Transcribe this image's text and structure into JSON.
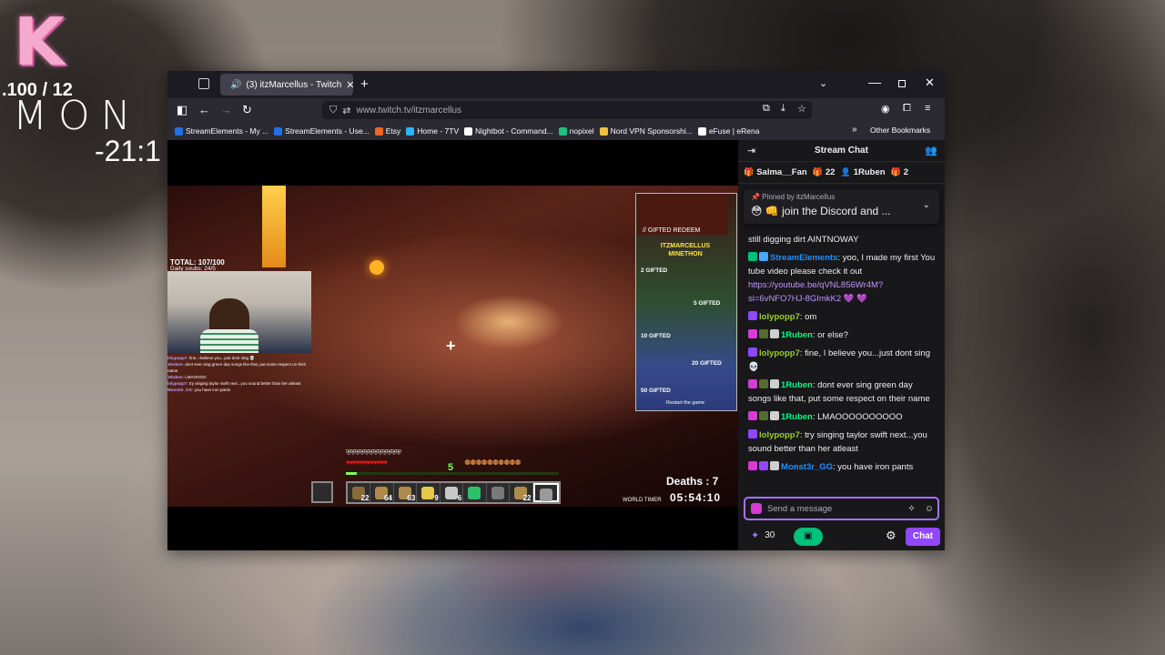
{
  "desktop": {
    "k_logo": "K",
    "counter": ".100 / 12",
    "mon_text": "MON",
    "clock": "-21:1"
  },
  "browser": {
    "tab_title": "(3) itzMarcellus - Twitch",
    "tab_close": "✕",
    "new_tab": "+",
    "url": "www.twitch.tv/itzmarcellus",
    "bookmarks": [
      {
        "label": "StreamElements - My ...",
        "color": "#1f6feb"
      },
      {
        "label": "StreamElements - Use...",
        "color": "#1f6feb"
      },
      {
        "label": "Etsy",
        "color": "#f1641e"
      },
      {
        "label": "Home - 7TV",
        "color": "#29b6f6"
      },
      {
        "label": "Nightbot - Command...",
        "color": "#ffffff"
      },
      {
        "label": "nopixel",
        "color": "#19c37d"
      },
      {
        "label": "Nord VPN Sponsorshi...",
        "color": "#f0c23b"
      },
      {
        "label": "eFuse | eRena",
        "color": "#ffffff"
      }
    ],
    "other_bookmarks": "Other Bookmarks"
  },
  "stream": {
    "total": "TOTAL: 107/100",
    "daily": "Daily soubs: 24/5",
    "mini_chat": [
      {
        "name": "lolypopp7:",
        "text": "fine, i believe you...just dont sing 💀"
      },
      {
        "name": "1Ruben:",
        "text": "dont ever sing green day songs like that, put some respect on their name"
      },
      {
        "name": "1Ruben:",
        "text": "LMAOOOO"
      },
      {
        "name": "lolypopp7:",
        "text": "try singing taylor swift next...you sound better than her atleast"
      },
      {
        "name": "Monst3r_GG:",
        "text": "you have iron pants"
      }
    ],
    "overlay": {
      "redeem": "// GIFTED REDEEM",
      "title": "ITZMARCELLUS MINETHON",
      "gifts": [
        "2 GIFTED",
        "5 GIFTED",
        "10 GIFTED",
        "20 GIFTED",
        "50 GIFTED"
      ],
      "restart": "Restart the game"
    },
    "deaths": "Deaths : 7",
    "world_timer_label": "WORLD TIMER",
    "world_timer": "05:54:10",
    "level": "5",
    "xp_fraction": 0.05,
    "hotbar": [
      {
        "count": "22",
        "color": "#8a6a3a"
      },
      {
        "count": "64",
        "color": "#b08a4a"
      },
      {
        "count": "63",
        "color": "#b08a4a"
      },
      {
        "count": "9",
        "color": "#e6c94a"
      },
      {
        "count": "6",
        "color": "#c8c8c8"
      },
      {
        "count": "",
        "color": "#2ec16a"
      },
      {
        "count": "",
        "color": "#7a7a7a"
      },
      {
        "count": "22",
        "color": "#b08a4a"
      },
      {
        "count": "",
        "color": "#9a9a9a"
      }
    ]
  },
  "chat": {
    "title": "Stream Chat",
    "leaderboard": [
      {
        "icon": "🎁",
        "label": "Salma__Fan",
        "color": "#e6c94a"
      },
      {
        "icon": "🎁",
        "label": "22",
        "color": "#6e8bff"
      },
      {
        "icon": "👤",
        "label": "1Ruben",
        "color": "#ffffff"
      },
      {
        "icon": "🎁",
        "label": "2",
        "color": "#a970ff"
      }
    ],
    "pinned_by_prefix": "Pinned by",
    "pinned_by_name": "itzMarcellus",
    "pinned_message": "😳 👊 join the Discord and ...",
    "messages": [
      {
        "name": "",
        "name_color": "#efeff1",
        "text": "still digging dirt AINTNOWAY",
        "link": ""
      },
      {
        "name": "StreamElements",
        "name_color": "#1e90ff",
        "text": ": yoo, I made my first You tube video please check it out ",
        "link": "https://youtube.be/qVNL856Wr4M?si=6vNFO7HJ-8GImkK2 💜 💜"
      },
      {
        "name": "lolypopp7",
        "name_color": "#9acd32",
        "text": ": om",
        "link": ""
      },
      {
        "name": "1Ruben",
        "name_color": "#00ff7f",
        "text": ": or else?",
        "link": ""
      },
      {
        "name": "lolypopp7",
        "name_color": "#9acd32",
        "text": ": fine, I believe you...just dont sing 💀",
        "link": ""
      },
      {
        "name": "1Ruben",
        "name_color": "#00ff7f",
        "text": ": dont ever sing green day songs like that, put some respect on their name",
        "link": ""
      },
      {
        "name": "1Ruben",
        "name_color": "#00ff7f",
        "text": ": LMAOOOOOOOOOO",
        "link": ""
      },
      {
        "name": "lolypopp7",
        "name_color": "#9acd32",
        "text": ": try singing taylor swift next...you sound better than her atleast",
        "link": ""
      },
      {
        "name": "Monst3r_GG",
        "name_color": "#1e90ff",
        "text": ": you have iron pants",
        "link": ""
      }
    ],
    "input_placeholder": "Send a message",
    "points": "30",
    "chat_button": "Chat"
  }
}
